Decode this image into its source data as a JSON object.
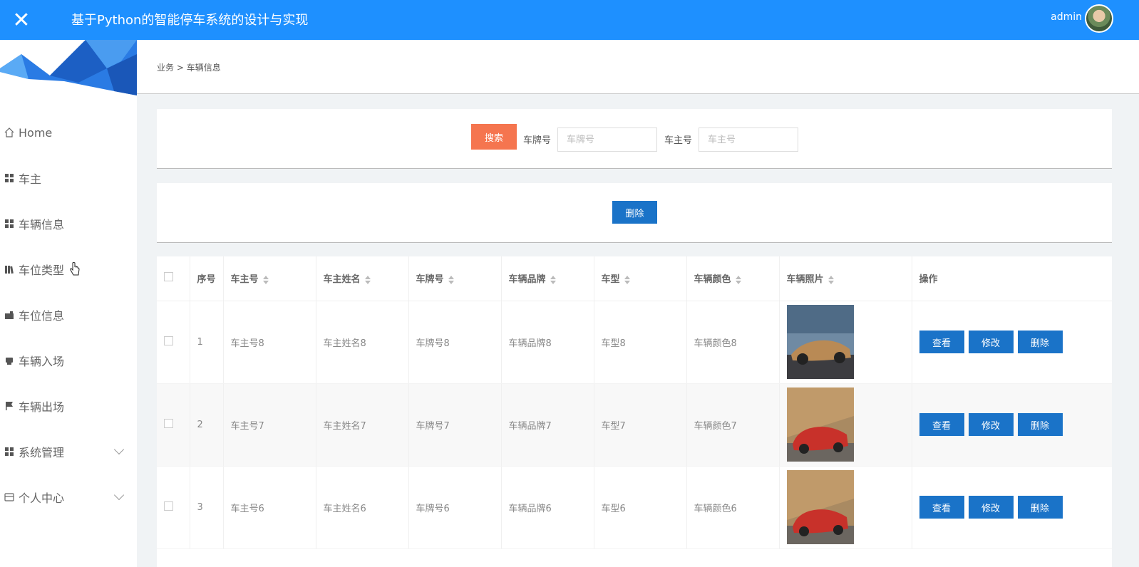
{
  "header": {
    "close_glyph": "✕",
    "title": "基于Python的智能停车系统的设计与实现",
    "username": "admin"
  },
  "sidebar": {
    "items": [
      {
        "label": "Home",
        "icon": "home-icon"
      },
      {
        "label": "车主",
        "icon": "grid-icon"
      },
      {
        "label": "车辆信息",
        "icon": "grid-icon"
      },
      {
        "label": "车位类型",
        "icon": "bookshelf-icon"
      },
      {
        "label": "车位信息",
        "icon": "briefcase-icon"
      },
      {
        "label": "车辆入场",
        "icon": "printer-icon"
      },
      {
        "label": "车辆出场",
        "icon": "flag-icon"
      },
      {
        "label": "系统管理",
        "icon": "grid-icon",
        "expandable": true
      },
      {
        "label": "个人中心",
        "icon": "card-icon",
        "expandable": true
      }
    ]
  },
  "breadcrumb": {
    "parent": "业务",
    "sep": ">",
    "current": "车辆信息"
  },
  "search": {
    "button": "搜索",
    "plate_label": "车牌号",
    "plate_placeholder": "车牌号",
    "owner_label": "车主号",
    "owner_placeholder": "车主号"
  },
  "actions": {
    "delete": "删除"
  },
  "table": {
    "columns": [
      "序号",
      "车主号",
      "车主姓名",
      "车牌号",
      "车辆品牌",
      "车型",
      "车辆颜色",
      "车辆照片",
      "操作"
    ],
    "rows": [
      {
        "index": "1",
        "owner_no": "车主号8",
        "owner_name": "车主姓名8",
        "plate": "车牌号8",
        "brand": "车辆品牌8",
        "model": "车型8",
        "color": "车辆颜色8",
        "photo_color": "#b98a55"
      },
      {
        "index": "2",
        "owner_no": "车主号7",
        "owner_name": "车主姓名7",
        "plate": "车牌号7",
        "brand": "车辆品牌7",
        "model": "车型7",
        "color": "车辆颜色7",
        "photo_color": "#c8312a"
      },
      {
        "index": "3",
        "owner_no": "车主号6",
        "owner_name": "车主姓名6",
        "plate": "车牌号6",
        "brand": "车辆品牌6",
        "model": "车型6",
        "color": "车辆颜色6",
        "photo_color": "#c8312a"
      }
    ],
    "row_buttons": {
      "view": "查看",
      "edit": "修改",
      "delete": "删除"
    }
  },
  "colors": {
    "topbar": "#1e90ff",
    "search_button": "#f5754f",
    "primary_button": "#1a73c8"
  }
}
